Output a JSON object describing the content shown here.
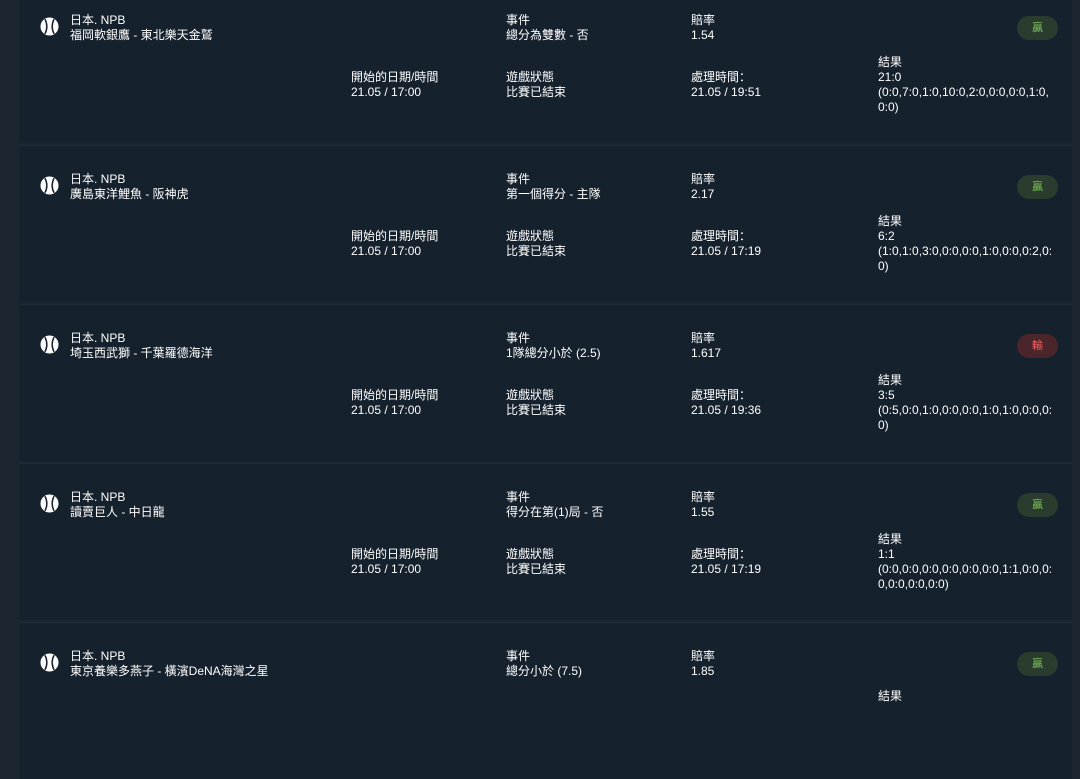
{
  "labels": {
    "event": "事件",
    "odds": "賠率",
    "start": "開始的日期/時間",
    "status": "遊戲狀態",
    "processed": "處理時間：",
    "result": "結果"
  },
  "bets": [
    {
      "league": "日本. NPB",
      "match": "福岡軟銀鷹 - 東北樂天金鷲",
      "event": "總分為雙數 - 否",
      "odds": "1.54",
      "start": "21.05 / 17:00",
      "status": "比賽已結束",
      "processed": "21.05 / 19:51",
      "score": "21:0",
      "detail": "(0:0,7:0,1:0,10:0,2:0,0:0,0:0,1:0,0:0)",
      "outcome": "贏",
      "outcome_type": "win"
    },
    {
      "league": "日本. NPB",
      "match": "廣島東洋鯉魚 - 阪神虎",
      "event": "第一個得分 - 主隊",
      "odds": "2.17",
      "start": "21.05 / 17:00",
      "status": "比賽已結束",
      "processed": "21.05 / 17:19",
      "score": "6:2",
      "detail": "(1:0,1:0,3:0,0:0,0:0,1:0,0:0,0:2,0:0)",
      "outcome": "贏",
      "outcome_type": "win"
    },
    {
      "league": "日本. NPB",
      "match": "埼玉西武獅 - 千葉羅德海洋",
      "event": "1隊總分小於 (2.5)",
      "odds": "1.617",
      "start": "21.05 / 17:00",
      "status": "比賽已結束",
      "processed": "21.05 / 19:36",
      "score": "3:5",
      "detail": "(0:5,0:0,1:0,0:0,0:0,1:0,1:0,0:0,0:0)",
      "outcome": "輸",
      "outcome_type": "lose"
    },
    {
      "league": "日本. NPB",
      "match": "讀賣巨人 - 中日龍",
      "event": "得分在第(1)局 - 否",
      "odds": "1.55",
      "start": "21.05 / 17:00",
      "status": "比賽已結束",
      "processed": "21.05 / 17:19",
      "score": "1:1",
      "detail": "(0:0,0:0,0:0,0:0,0:0,0:0,1:1,0:0,0:0,0:0,0:0,0:0)",
      "outcome": "贏",
      "outcome_type": "win"
    },
    {
      "league": "日本. NPB",
      "match": "東京養樂多燕子 - 橫濱DeNA海灣之星",
      "event": "總分小於 (7.5)",
      "odds": "1.85",
      "outcome": "贏",
      "outcome_type": "win"
    }
  ],
  "icon": "baseball-icon",
  "colors": {
    "background": "#1b2631",
    "card": "#15212d",
    "win_bg": "#2a3c2d",
    "win_text": "#7cc05a",
    "lose_bg": "#4a2529",
    "lose_text": "#ff5b5b"
  }
}
